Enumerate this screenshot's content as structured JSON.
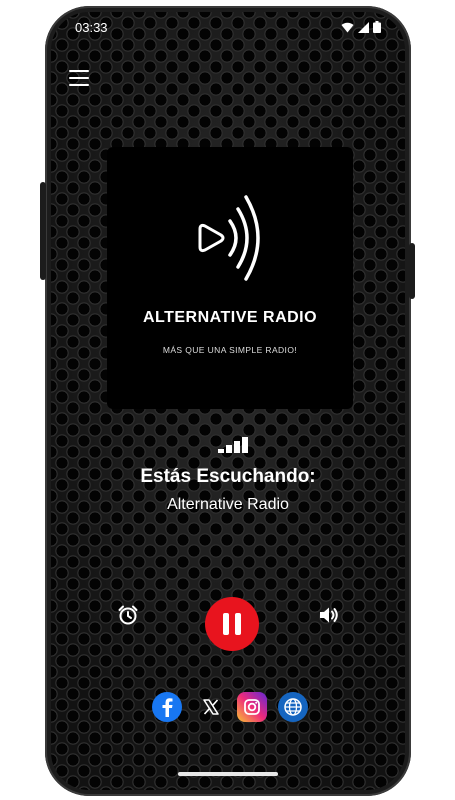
{
  "status_bar": {
    "time": "03:33",
    "icons": [
      "wifi-icon",
      "signal-icon",
      "battery-icon"
    ]
  },
  "menu": {
    "icon": "hamburger-menu-icon"
  },
  "album": {
    "logo_icon": "play-broadcast-icon",
    "station_name": "ALTERNATIVE RADIO",
    "tagline": "MÁS QUE UNA SIMPLE RADIO!"
  },
  "now_playing": {
    "signal_icon": "signal-bars-icon",
    "title": "Estás Escuchando:",
    "station": "Alternative Radio"
  },
  "controls": {
    "alarm_icon": "alarm-clock-icon",
    "pause_icon": "pause-icon",
    "volume_icon": "volume-icon"
  },
  "social": [
    "facebook-icon",
    "x-icon",
    "instagram-icon",
    "globe-icon"
  ],
  "colors": {
    "accent": "#e8141e",
    "facebook": "#1877f2",
    "globe": "#1565c0"
  }
}
